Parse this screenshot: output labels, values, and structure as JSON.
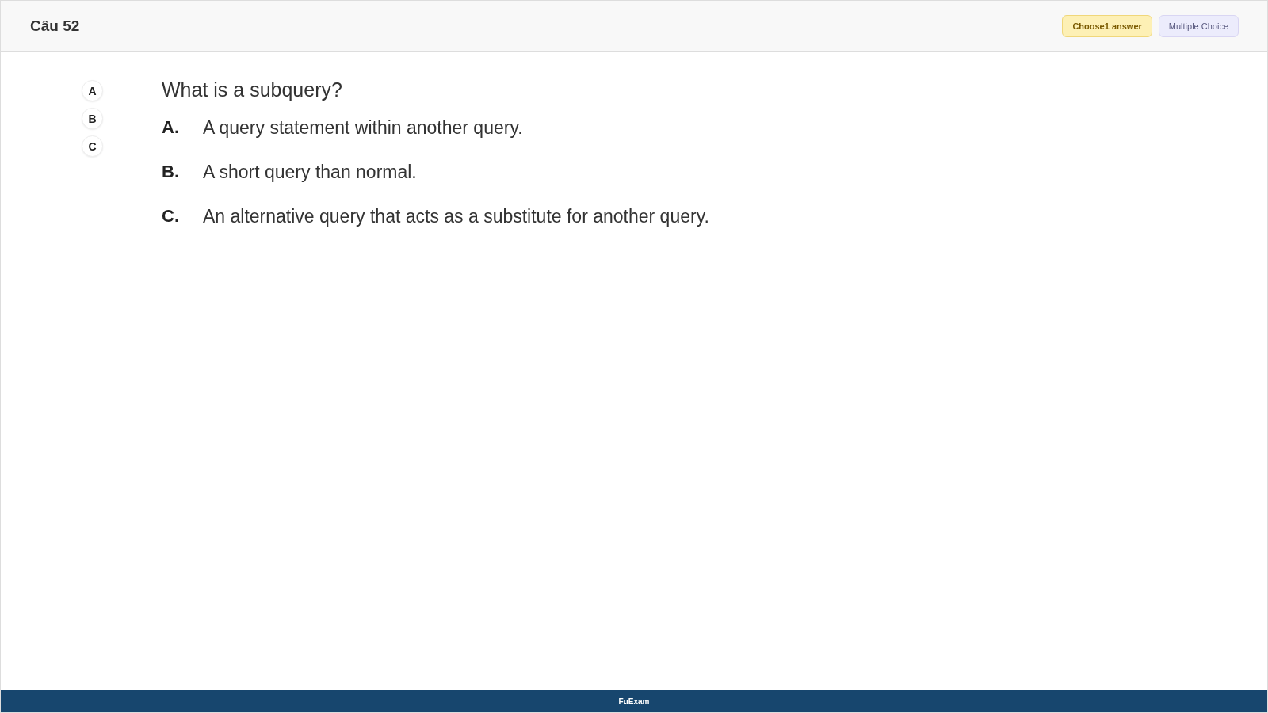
{
  "header": {
    "title": "Câu 52",
    "badges": [
      {
        "kind": "hint",
        "label": "Choose1 answer"
      },
      {
        "kind": "type",
        "label": "Multiple Choice"
      }
    ]
  },
  "answer_buttons": [
    "A",
    "B",
    "C"
  ],
  "question": "What is a subquery?",
  "options": [
    {
      "letter": "A.",
      "text": "A query statement within another query."
    },
    {
      "letter": "B.",
      "text": "A short query than normal."
    },
    {
      "letter": "C.",
      "text": "An alternative query that acts as a substitute for another query."
    }
  ],
  "footer": "FuExam"
}
